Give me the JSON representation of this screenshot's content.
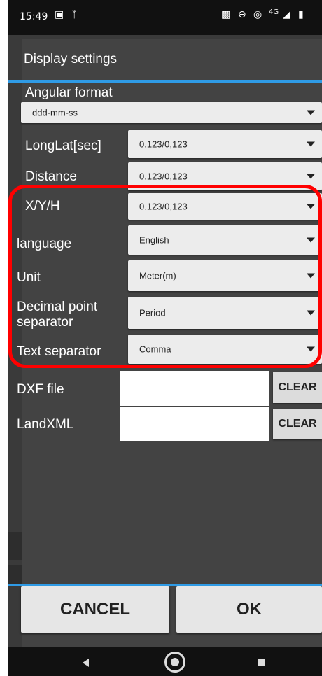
{
  "status_bar": {
    "time": "15:49",
    "left_icons": [
      "image-icon",
      "activity-icon"
    ],
    "right_icons": [
      "vibrate-icon",
      "dnd-icon",
      "hotspot-icon",
      "network-4g-icon",
      "signal-icon",
      "battery-icon"
    ],
    "network_label": "4G"
  },
  "dialog": {
    "title": "Display settings",
    "angular_format": {
      "label": "Angular format",
      "value": "ddd-mm-ss"
    },
    "rows": [
      {
        "label": "LongLat[sec]",
        "value": "0.123/0,123"
      },
      {
        "label": "Distance",
        "value": "0.123/0,123"
      },
      {
        "label": "X/Y/H",
        "value": "0.123/0,123"
      },
      {
        "label": "language",
        "value": "English"
      },
      {
        "label": "Unit",
        "value": "Meter(m)"
      },
      {
        "label": "Decimal point separator",
        "value": "Period"
      },
      {
        "label": "Text separator",
        "value": "Comma"
      }
    ],
    "files": [
      {
        "label": "DXF file",
        "value": "",
        "button": "CLEAR"
      },
      {
        "label": "LandXML",
        "value": "",
        "button": "CLEAR"
      }
    ],
    "cancel_label": "CANCEL",
    "ok_label": "OK"
  },
  "colors": {
    "accent": "#2f9be6",
    "highlight": "#ff0000",
    "dialog_bg": "#434343"
  },
  "nav_bar": {
    "icons": [
      "back-icon",
      "home-icon",
      "recents-icon"
    ]
  }
}
